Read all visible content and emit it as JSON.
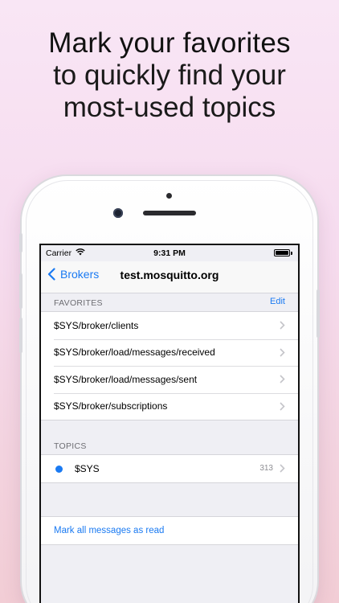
{
  "headline": {
    "line1": "Mark your favorites",
    "line2": "to quickly find your",
    "line3": "most-used topics"
  },
  "status_bar": {
    "carrier": "Carrier",
    "time": "9:31 PM"
  },
  "navbar": {
    "back_label": "Brokers",
    "title": "test.mosquitto.org"
  },
  "favorites": {
    "header": "FAVORITES",
    "edit_label": "Edit",
    "items": [
      {
        "label": "$SYS/broker/clients"
      },
      {
        "label": "$SYS/broker/load/messages/received"
      },
      {
        "label": "$SYS/broker/load/messages/sent"
      },
      {
        "label": "$SYS/broker/subscriptions"
      }
    ]
  },
  "topics": {
    "header": "TOPICS",
    "items": [
      {
        "label": "$SYS",
        "count": "313"
      }
    ]
  },
  "actions": {
    "mark_all_read": "Mark all messages as read"
  },
  "colors": {
    "accent": "#1a7af2",
    "unread_dot": "#1a7af2"
  }
}
